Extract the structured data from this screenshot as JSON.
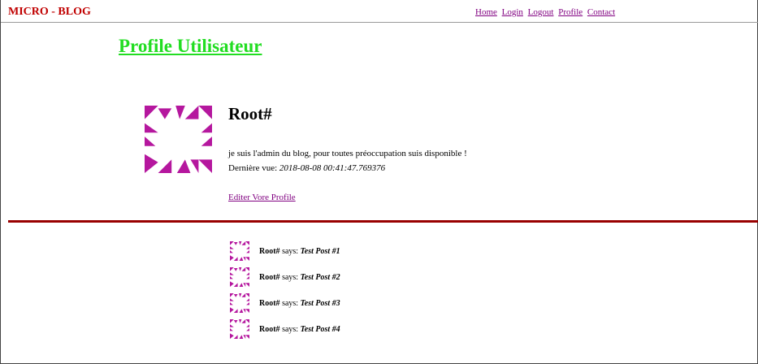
{
  "header": {
    "brand": "MICRO - BLOG",
    "nav": [
      {
        "label": "Home"
      },
      {
        "label": "Login"
      },
      {
        "label": "Logout"
      },
      {
        "label": "Profile"
      },
      {
        "label": "Contact"
      }
    ]
  },
  "profile": {
    "page_title": "Profile Utilisateur",
    "username": "Root#",
    "bio": "je suis l'admin du blog, pour toutes préoccupation suis disponible !",
    "last_seen_label": "Dernière vue:",
    "last_seen": "2018-08-08 00:41:47.769376",
    "edit_link": "Editer Vore Profile",
    "avatar_color": "#b5179e"
  },
  "colors": {
    "brand": "#c00000",
    "title": "#22dd22",
    "link": "#800080",
    "divider": "#990000"
  },
  "posts": [
    {
      "author": "Root#",
      "says": "says:",
      "body": "Test Post #1"
    },
    {
      "author": "Root#",
      "says": "says:",
      "body": "Test Post #2"
    },
    {
      "author": "Root#",
      "says": "says:",
      "body": "Test Post #3"
    },
    {
      "author": "Root#",
      "says": "says:",
      "body": "Test Post #4"
    }
  ]
}
